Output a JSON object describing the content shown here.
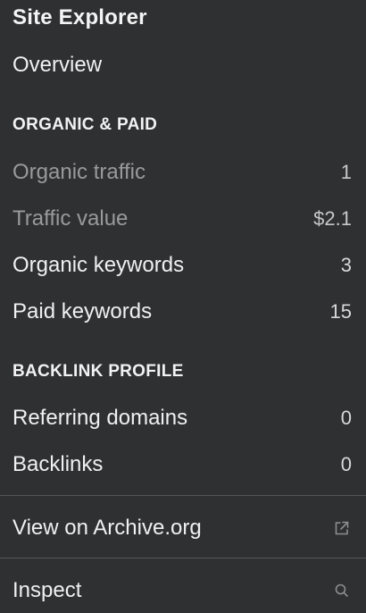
{
  "menu": {
    "title": "Site Explorer",
    "overview": "Overview",
    "sections": {
      "organic_paid": "ORGANIC & PAID",
      "backlink_profile": "BACKLINK PROFILE"
    },
    "organic_items": [
      {
        "label": "Organic traffic",
        "value": "1"
      },
      {
        "label": "Traffic value",
        "value": "$2.1"
      },
      {
        "label": "Organic keywords",
        "value": "3"
      },
      {
        "label": "Paid keywords",
        "value": "15"
      }
    ],
    "backlink_items": [
      {
        "label": "Referring domains",
        "value": "0"
      },
      {
        "label": "Backlinks",
        "value": "0"
      }
    ],
    "archive_link": "View on Archive.org",
    "inspect": "Inspect",
    "icons": {
      "archive": "external-link-icon",
      "inspect": "search-icon"
    },
    "colors": {
      "background": "#2f3032",
      "text": "#f0f0f0",
      "dim_text": "#9a9a9c",
      "divider": "#555659"
    }
  }
}
